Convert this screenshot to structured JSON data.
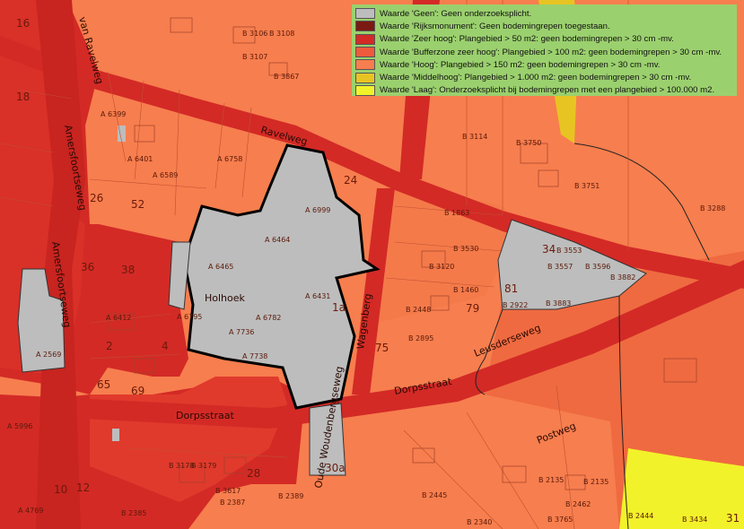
{
  "legend": {
    "items": [
      {
        "label": "Waarde 'Geen': Geen onderzoeksplicht.",
        "color": "#bdbdbd"
      },
      {
        "label": "Waarde 'Rijksmonument': Geen bodemingrepen toegestaan.",
        "color": "#7a1a12"
      },
      {
        "label": "Waarde 'Zeer hoog': Plangebied > 50 m2: geen bodemingrepen > 30 cm -mv.",
        "color": "#d32a26"
      },
      {
        "label": "Waarde 'Bufferzone zeer hoog': Plangebied > 100 m2: geen bodemingrepen > 30 cm -mv.",
        "color": "#ef5a3c"
      },
      {
        "label": "Waarde 'Hoog': Plangebied > 150 m2: geen bodemingrepen > 30 cm -mv.",
        "color": "#f77e4e"
      },
      {
        "label": "Waarde 'Middelhoog': Plangebied > 1.000 m2: geen bodemingrepen > 30 cm -mv.",
        "color": "#e8c422"
      },
      {
        "label": "Waarde 'Laag': Onderzoeksplicht bij bodemingrepen met een plangebied > 100.000 m2.",
        "color": "#f2f22a"
      }
    ]
  },
  "streets": {
    "dorpsstraat": "Dorpsstraat",
    "dorpsstraat_east": "Dorpsstraat",
    "postweg": "Postweg",
    "amersfoortseweg": "Amersfoortseweg",
    "amersfoortseweg_2": "Amersfoortseweg",
    "leusderweg": "Leusderseweg",
    "wagenberg": "Wagenberg",
    "van_ravelweg": "van Ravelweg",
    "holhoek": "Holhoek",
    "oude_woudenbergseweg": "Oude Woudenbergseweg",
    "ravelweg_top": "Ravelweg"
  },
  "parcels": [
    "A 6464",
    "A 6465",
    "A 6431",
    "A 6782",
    "A 7736",
    "A 7738",
    "A 6999",
    "A 6589",
    "A 6401",
    "A 6412",
    "A 6758",
    "B 3106",
    "B 3107",
    "B 3108",
    "B 3867",
    "B 3114",
    "B 3750",
    "B 3751",
    "B 3288",
    "B 1863",
    "B 3530",
    "B 3120",
    "B 1460",
    "B 2448",
    "B 2895",
    "B 3882",
    "B 3883",
    "B 2922",
    "B 3557",
    "B 3596",
    "B 3553",
    "B 2387",
    "B 2389",
    "B 2385",
    "B 3617",
    "B 3178",
    "B 3179",
    "B 2462",
    "B 2135",
    "B 2135",
    "B 2444",
    "B 3765",
    "B 2340",
    "B 2445",
    "B 3434",
    "A 5996",
    "A 2569",
    "A 6399",
    "A 4769",
    "A 6795"
  ],
  "house_numbers": [
    "52",
    "26",
    "38",
    "36",
    "24",
    "1a",
    "75",
    "79",
    "81",
    "2",
    "4",
    "69",
    "65",
    "28",
    "30a",
    "34",
    "31",
    "10",
    "12",
    "16",
    "18"
  ]
}
